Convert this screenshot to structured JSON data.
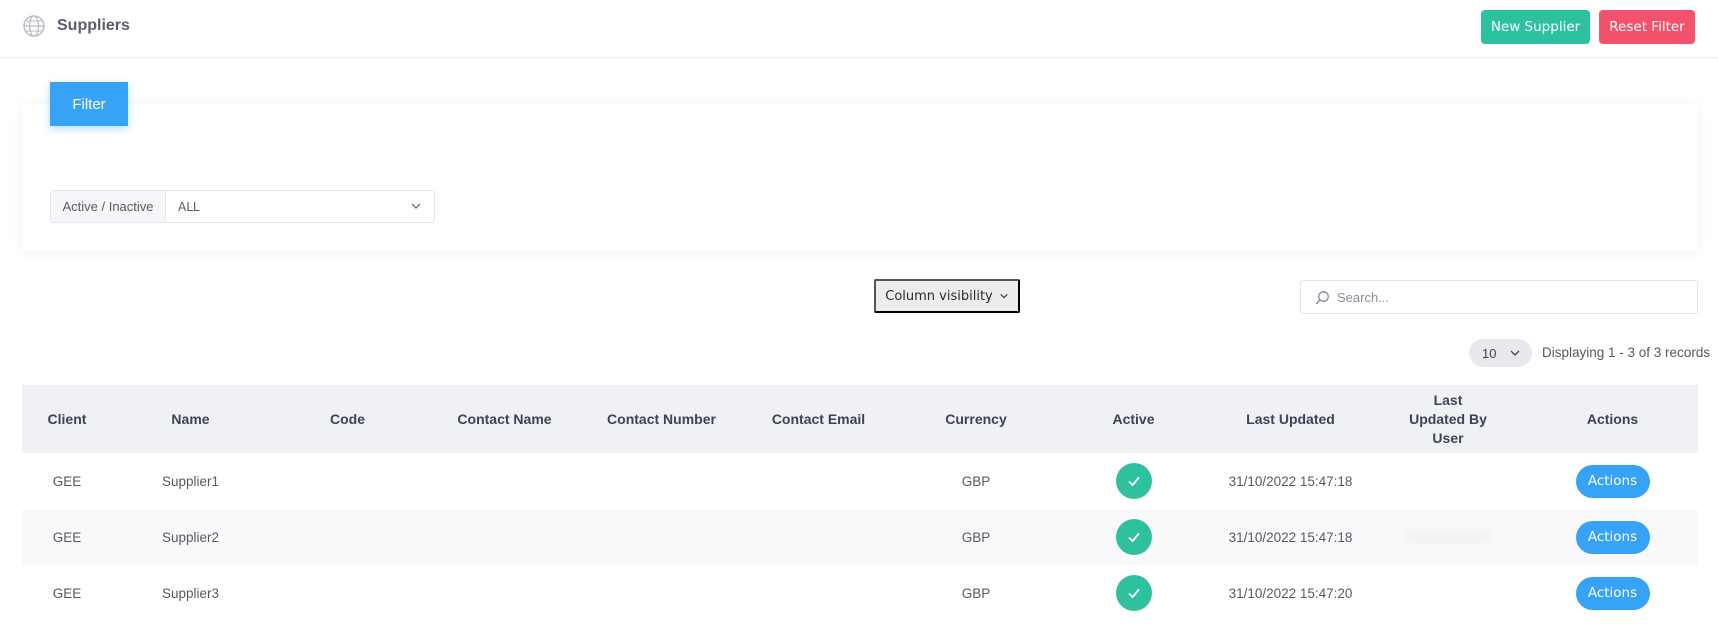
{
  "header": {
    "title": "Suppliers",
    "new_supplier_label": "New Supplier",
    "reset_filter_label": "Reset Filter"
  },
  "filter": {
    "tab_label": "Filter",
    "active_label": "Active / Inactive",
    "active_value": "ALL"
  },
  "toolbar": {
    "column_visibility_label": "Column visibility",
    "search_placeholder": "Search...",
    "page_size": "10",
    "displaying_text": "Displaying 1 - 3 of 3 records"
  },
  "table": {
    "columns": [
      "Client",
      "Name",
      "Code",
      "Contact Name",
      "Contact Number",
      "Contact Email",
      "Currency",
      "Active",
      "Last Updated",
      "Last Updated By User",
      "Actions"
    ],
    "rows": [
      {
        "client": "GEE",
        "name": "Supplier1",
        "code": "",
        "contact_name": "",
        "contact_number": "",
        "contact_email": "",
        "currency": "GBP",
        "active": true,
        "last_updated": "31/10/2022 15:47:18",
        "last_updated_by": "",
        "action_label": "Actions"
      },
      {
        "client": "GEE",
        "name": "Supplier2",
        "code": "",
        "contact_name": "",
        "contact_number": "",
        "contact_email": "",
        "currency": "GBP",
        "active": true,
        "last_updated": "31/10/2022 15:47:18",
        "last_updated_by": "",
        "action_label": "Actions"
      },
      {
        "client": "GEE",
        "name": "Supplier3",
        "code": "",
        "contact_name": "",
        "contact_number": "",
        "contact_email": "",
        "currency": "GBP",
        "active": true,
        "last_updated": "31/10/2022 15:47:20",
        "last_updated_by": "",
        "action_label": "Actions"
      }
    ]
  },
  "colors": {
    "success": "#2ec1a0",
    "danger": "#f4516c",
    "primary": "#36a3f7"
  }
}
